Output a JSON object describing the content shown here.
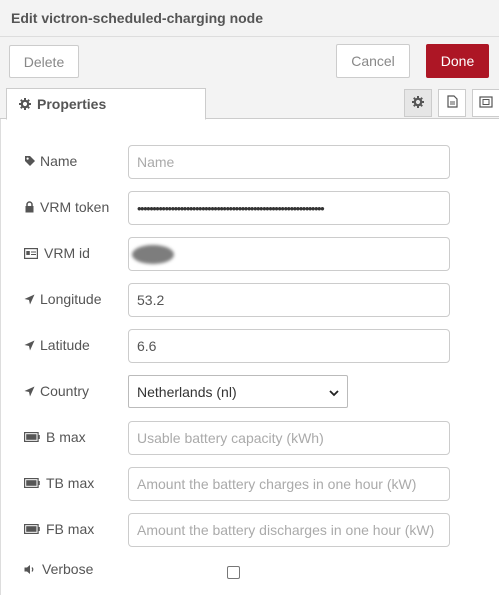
{
  "dialog": {
    "title": "Edit victron-scheduled-charging node"
  },
  "toolbar": {
    "delete_label": "Delete",
    "cancel_label": "Cancel",
    "done_label": "Done"
  },
  "tabs": [
    {
      "label": "Properties",
      "icon": "gear-icon"
    }
  ],
  "tab_icons": [
    "gear-icon",
    "document-icon",
    "frame-icon"
  ],
  "colors": {
    "done": "#ad1625",
    "titlebar": "#f3f3f3"
  },
  "form": {
    "name": {
      "label": "Name",
      "placeholder": "Name",
      "value": "",
      "icon": "tag-icon"
    },
    "vrm_token": {
      "label": "VRM token",
      "value": "•••••••••••••••••••••••••••••••••••••••••••••••••••••••••••••",
      "icon": "lock-icon"
    },
    "vrm_id": {
      "label": "VRM id",
      "value_hidden": true,
      "icon": "id-card-icon"
    },
    "longitude": {
      "label": "Longitude",
      "value": "53.2",
      "icon": "location-arrow-icon"
    },
    "latitude": {
      "label": "Latitude",
      "value": "6.6",
      "icon": "location-arrow-icon"
    },
    "country": {
      "label": "Country",
      "selected": "Netherlands (nl)",
      "icon": "location-arrow-icon"
    },
    "b_max": {
      "label": "B max",
      "placeholder": "Usable battery capacity (kWh)",
      "icon": "battery-icon"
    },
    "tb_max": {
      "label": "TB max",
      "placeholder": "Amount the battery charges in one hour (kW)",
      "icon": "battery-icon"
    },
    "fb_max": {
      "label": "FB max",
      "placeholder": "Amount the battery discharges in one hour (kW)",
      "icon": "battery-icon"
    },
    "verbose": {
      "label": "Verbose",
      "checked": false,
      "icon": "volume-icon"
    }
  }
}
